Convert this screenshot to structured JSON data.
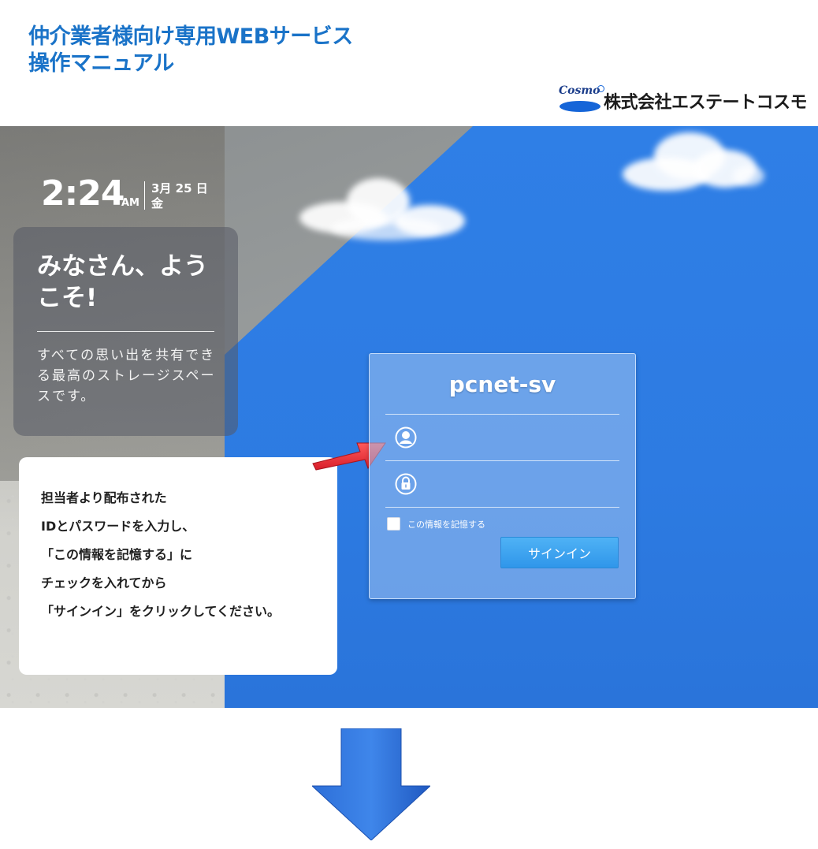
{
  "document": {
    "title_line1": "仲介業者様向け専用WEBサービス",
    "title_line2": "操作マニュアル",
    "company_logo_word": "Cosmo",
    "company_name": "株式会社エステートコスモ",
    "brand_color": "#1a73c8"
  },
  "lock_screen": {
    "time": "2:24",
    "ampm": "AM",
    "date": "3月 25 日",
    "weekday": "金",
    "welcome_title": "みなさん、ようこそ!",
    "welcome_text": "すべての思い出を共有できる最高のストレージスペースです。"
  },
  "login": {
    "host": "pcnet-sv",
    "username_icon": "user-icon",
    "password_icon": "lock-icon",
    "username_value": "",
    "password_value": "",
    "remember_label": "この情報を記憶する",
    "remember_checked": false,
    "signin_label": "サインイン",
    "button_color": "#3aa0ee"
  },
  "instruction": {
    "text": " 担当者より配布された\nIDとパスワードを入力し、\n「この情報を記憶する」に\nチェックを入れてから\n「サインイン」をクリックしてください。",
    "pointer_icon": "red-arrow-icon",
    "next_step_icon": "down-arrow-icon"
  }
}
